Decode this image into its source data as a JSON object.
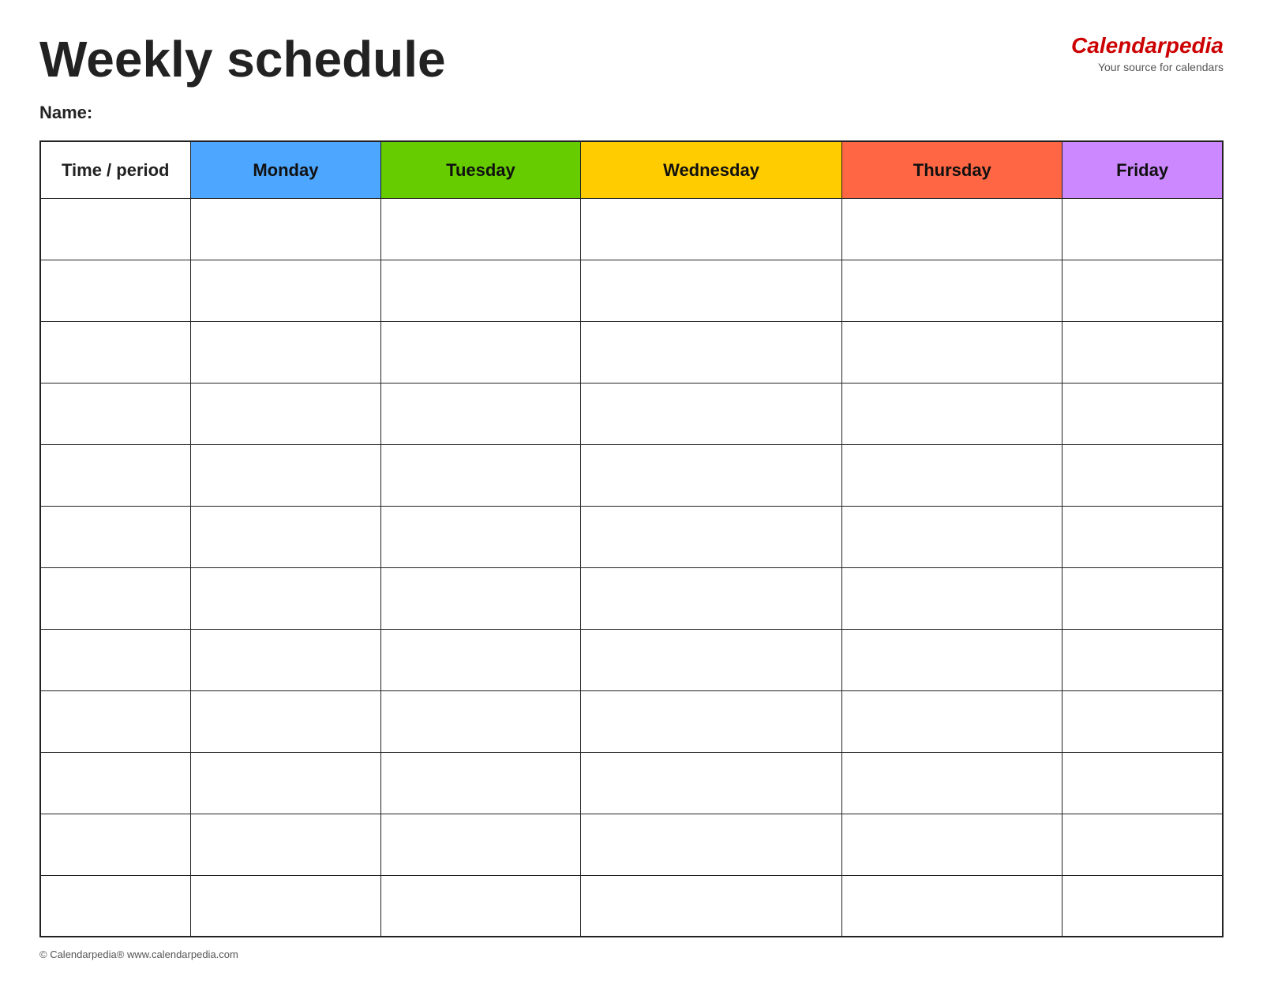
{
  "header": {
    "title": "Weekly schedule",
    "logo_main": "Calendar",
    "logo_italic": "pedia",
    "logo_sub": "Your source for calendars"
  },
  "name_label": "Name:",
  "columns": [
    {
      "id": "time",
      "label": "Time / period",
      "class": "col-time"
    },
    {
      "id": "monday",
      "label": "Monday",
      "class": "col-monday"
    },
    {
      "id": "tuesday",
      "label": "Tuesday",
      "class": "col-tuesday"
    },
    {
      "id": "wednesday",
      "label": "Wednesday",
      "class": "col-wednesday"
    },
    {
      "id": "thursday",
      "label": "Thursday",
      "class": "col-thursday"
    },
    {
      "id": "friday",
      "label": "Friday",
      "class": "col-friday"
    }
  ],
  "row_count": 12,
  "footer": "© Calendarpedia®  www.calendarpedia.com"
}
